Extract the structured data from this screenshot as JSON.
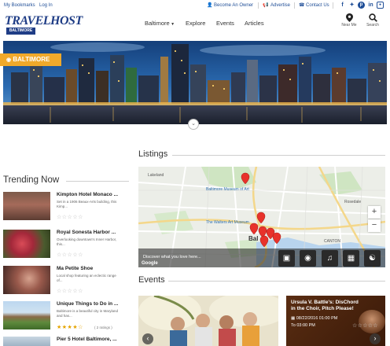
{
  "topbar": {
    "my_bookmarks": "My Bookmarks",
    "login": "Log In",
    "become_owner": "Become An Owner",
    "advertise": "Advertise",
    "contact_us": "Contact Us"
  },
  "header": {
    "logo": "TRAVELHOST",
    "city_badge": "BALTIMORE",
    "nav": [
      {
        "label": "Baltimore"
      },
      {
        "label": "Explore"
      },
      {
        "label": "Events"
      },
      {
        "label": "Articles"
      }
    ],
    "near_me": "Near Me",
    "search": "Search"
  },
  "hero": {
    "location_label": "BALTIMORE"
  },
  "listings": {
    "heading": "Listings",
    "map_prompt": "Discover what you love here...",
    "google_label": "Google",
    "map_labels": [
      "Lakeland",
      "Baltimore Museum of Art",
      "The Walters Art Museum",
      "Bal",
      "Rosedale",
      "CANTON"
    ]
  },
  "trending": {
    "heading": "Trending Now",
    "items": [
      {
        "title": "Kimpton Hotel Monaco ...",
        "desc": "Set in a 1906 Beaux-Arts building, this Kimp...",
        "rating_count": ""
      },
      {
        "title": "Royal Sonesta Harbor ...",
        "desc": "Overlooking downtown's Inner Harbor, this...",
        "rating_count": ""
      },
      {
        "title": "Ma Petite Shoe",
        "desc": "Local shop featuring an eclectic range of...",
        "rating_count": ""
      },
      {
        "title": "Unique Things to Do in ...",
        "desc": "Baltimore is a beautiful city in Maryland and has...",
        "rating_count": "( 2 ratings )"
      },
      {
        "title": "Pier 5 Hotel Baltimore, ...",
        "desc": "",
        "rating_count": ""
      }
    ]
  },
  "events": {
    "heading": "Events",
    "card_title": "Ursula V. Battle's: DisChord in the Choir, Pitch Please!",
    "card_date": "08/22/2016 01:00 PM",
    "card_to": "To 03:00 PM"
  },
  "colors": {
    "brand_blue": "#1f3d86",
    "accent_orange": "#f0a92a",
    "link_blue": "#1f4e97",
    "pin_red": "#e8322b"
  }
}
